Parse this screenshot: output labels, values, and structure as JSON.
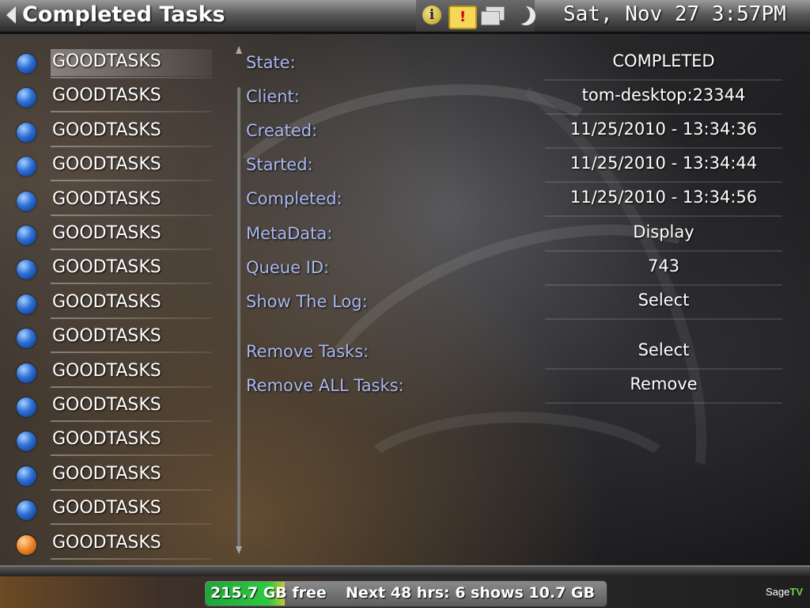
{
  "header": {
    "title": "Completed Tasks",
    "clock": "Sat, Nov 27 3:57PM",
    "icons": [
      "info-icon",
      "tv-alert-icon",
      "windows-icon",
      "moon-icon"
    ]
  },
  "tasks": [
    {
      "label": "GOODTASKS",
      "status": "blue"
    },
    {
      "label": "GOODTASKS",
      "status": "blue"
    },
    {
      "label": "GOODTASKS",
      "status": "blue"
    },
    {
      "label": "GOODTASKS",
      "status": "blue"
    },
    {
      "label": "GOODTASKS",
      "status": "blue"
    },
    {
      "label": "GOODTASKS",
      "status": "blue"
    },
    {
      "label": "GOODTASKS",
      "status": "blue"
    },
    {
      "label": "GOODTASKS",
      "status": "blue"
    },
    {
      "label": "GOODTASKS",
      "status": "blue"
    },
    {
      "label": "GOODTASKS",
      "status": "blue"
    },
    {
      "label": "GOODTASKS",
      "status": "blue"
    },
    {
      "label": "GOODTASKS",
      "status": "blue"
    },
    {
      "label": "GOODTASKS",
      "status": "blue"
    },
    {
      "label": "GOODTASKS",
      "status": "blue"
    },
    {
      "label": "GOODTASKS",
      "status": "orange"
    }
  ],
  "details": [
    {
      "label": "State:",
      "value": "COMPLETED"
    },
    {
      "label": "Client:",
      "value": "tom-desktop:23344"
    },
    {
      "label": "Created:",
      "value": "11/25/2010 - 13:34:36"
    },
    {
      "label": "Started:",
      "value": "11/25/2010 - 13:34:44"
    },
    {
      "label": "Completed:",
      "value": "11/25/2010 - 13:34:56"
    },
    {
      "label": "MetaData:",
      "value": "Display"
    },
    {
      "label": "Queue ID:",
      "value": "743"
    },
    {
      "label": "Show The Log:",
      "value": "Select"
    },
    {
      "label": "Remove Tasks:",
      "value": "Select"
    },
    {
      "label": "Remove ALL Tasks:",
      "value": "Remove"
    }
  ],
  "footer": {
    "disk_free": "215.7 GB free",
    "next_shows": "Next 48 hrs: 6 shows 10.7 GB",
    "logo_sage": "Sage",
    "logo_tv": "TV"
  },
  "colors": {
    "label": "#a9b8f0",
    "status_blue": "#2d6fd6",
    "status_orange": "#f08a2a",
    "disk_green": "#2fc83f"
  }
}
